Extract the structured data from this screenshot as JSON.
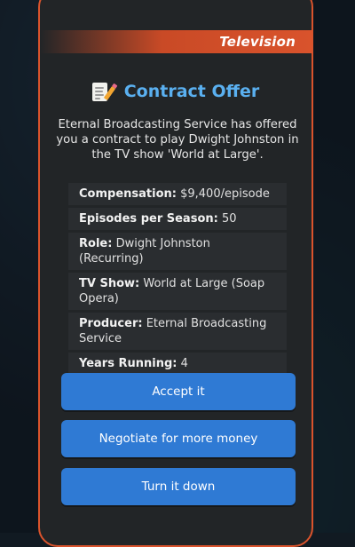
{
  "dialog": {
    "category": "Television",
    "title": "Contract Offer",
    "title_icon": "document-pencil-icon",
    "description": "Eternal Broadcasting Service has offered you a contract to play Dwight Johnston in the TV show 'World at Large'."
  },
  "details": [
    {
      "label": "Compensation:",
      "value": "$9,400/episode"
    },
    {
      "label": "Episodes per Season:",
      "value": "50"
    },
    {
      "label": "Role:",
      "value": "Dwight Johnston (Recurring)"
    },
    {
      "label": "TV Show:",
      "value": "World at Large (Soap Opera)"
    },
    {
      "label": "Producer:",
      "value": "Eternal Broadcasting Service"
    },
    {
      "label": "Years Running:",
      "value": "4"
    }
  ],
  "actions": {
    "accept_label": "Accept it",
    "negotiate_label": "Negotiate for more money",
    "decline_label": "Turn it down"
  },
  "colors": {
    "accent_border": "#d9532c",
    "title_blue": "#5ab0f0",
    "button_blue": "#2f7ad4",
    "panel_bg": "#222527"
  }
}
